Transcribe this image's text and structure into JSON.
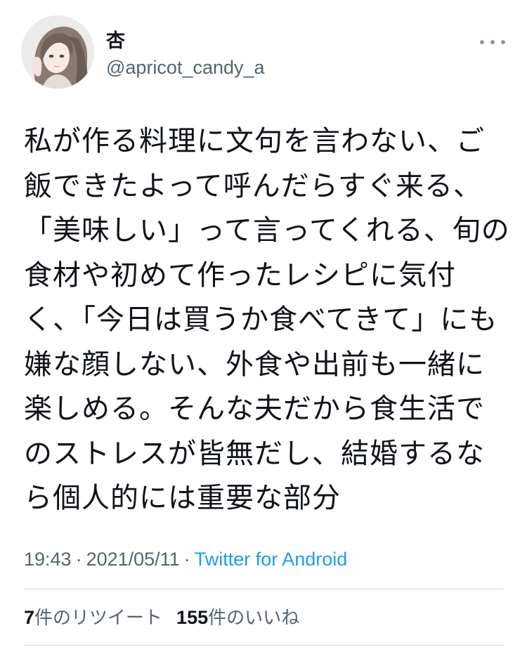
{
  "user": {
    "display_name": "杏",
    "handle": "@apricot_candy_a",
    "avatar": "avatar-illustration"
  },
  "more_icon": "more-horizontal-icon",
  "tweet": {
    "lines": [
      "私が作る料理に文句を言わない、ご",
      "飯できたよって呼んだらすぐ来る、",
      "「美味しい」って言ってくれる、旬の",
      "食材や初めて作ったレシピに気付",
      "く、「今日は買うか食べてきて」にも",
      "嫌な顔しない、外食や出前も一緒に",
      "楽しめる。そんな夫だから食生活で",
      "のストレスが皆無だし、結婚するな",
      "ら個人的には重要な部分"
    ]
  },
  "meta": {
    "time": "19:43",
    "separator": "·",
    "date": "2021/05/11",
    "source": "Twitter for Android"
  },
  "stats": {
    "retweets_count": "7",
    "retweets_label": "件のリツイート",
    "likes_count": "155",
    "likes_label": "件のいいね"
  },
  "colors": {
    "text": "#0f1419",
    "secondary": "#536471",
    "link": "#1d9bf0",
    "divider": "#cfd9de"
  }
}
